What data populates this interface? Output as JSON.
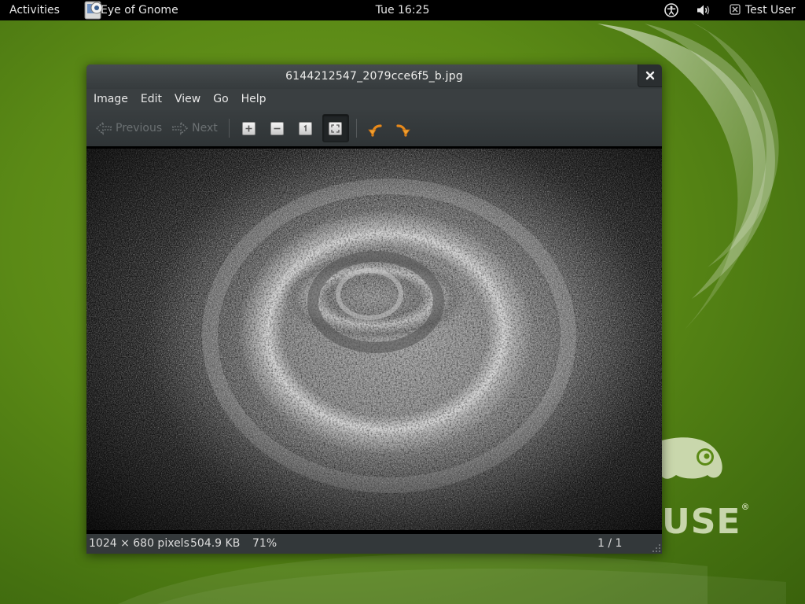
{
  "panel": {
    "activities": "Activities",
    "app_name": "Eye of Gnome",
    "clock": "Tue 16:25",
    "user": "Test User"
  },
  "window": {
    "title": "6144212547_2079cce6f5_b.jpg",
    "menu": [
      "Image",
      "Edit",
      "View",
      "Go",
      "Help"
    ],
    "toolbar": {
      "previous": "Previous",
      "next": "Next"
    },
    "status": {
      "dimensions": "1024 × 680 pixels",
      "filesize": "504.9 KB",
      "zoom": "71%",
      "position": "1 / 1"
    }
  },
  "colors": {
    "desktop_green": "#5b8a16",
    "panel_bg": "#000000",
    "window_bg": "#2e3436",
    "rotate_icon": "#f0a030"
  },
  "icons": {
    "accessibility": "accessibility-icon",
    "volume": "volume-icon",
    "user_status": "status-offline-icon",
    "zoom_in": "zoom-in-icon",
    "zoom_out": "zoom-out-icon",
    "normal_size": "zoom-original-icon",
    "best_fit": "zoom-fit-icon",
    "rotate_left": "rotate-left-icon",
    "rotate_right": "rotate-right-icon"
  }
}
